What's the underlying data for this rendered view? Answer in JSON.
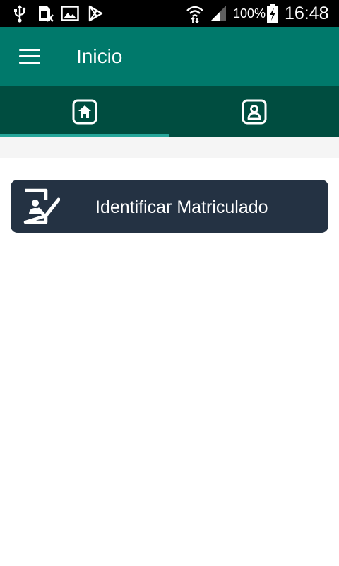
{
  "status_bar": {
    "battery_percent": "100%",
    "time": "16:48",
    "icons": [
      "usb-icon",
      "sim-icon",
      "image-icon",
      "play-store-icon",
      "wifi-icon",
      "signal-icon",
      "battery-charging-icon"
    ]
  },
  "app_bar": {
    "title": "Inicio",
    "menu_icon": "menu-icon"
  },
  "tabs": [
    {
      "icon": "home-icon",
      "selected": true
    },
    {
      "icon": "profile-icon",
      "selected": false
    }
  ],
  "main": {
    "identify_button": {
      "label": "Identificar Matriculado",
      "icon": "id-check-icon"
    }
  },
  "colors": {
    "status_bar": "#000000",
    "app_bar": "#00796b",
    "tab_bar": "#004d40",
    "tab_indicator": "#26a69a",
    "button_background": "#243243",
    "page_background": "#ffffff"
  }
}
